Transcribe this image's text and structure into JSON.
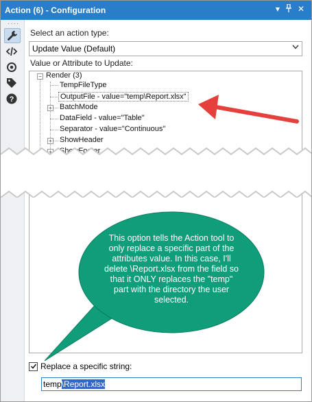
{
  "window": {
    "title": "Action (6) - Configuration"
  },
  "titlebar_icons": [
    "chevron-down-icon",
    "pin-icon",
    "close-icon"
  ],
  "sidebar": {
    "items": [
      {
        "name": "wrench-icon",
        "active": true
      },
      {
        "name": "code-icon",
        "active": false
      },
      {
        "name": "target-icon",
        "active": false
      },
      {
        "name": "tag-icon",
        "active": false
      },
      {
        "name": "help-icon",
        "active": false
      }
    ],
    "footer_icon": "checkmark-circle-icon"
  },
  "action_type": {
    "label": "Select an action type:",
    "value": "Update Value (Default)"
  },
  "tree": {
    "label": "Value or Attribute to Update:",
    "root": "Render (3)",
    "items": [
      {
        "text": "TempFileType",
        "expandable": false
      },
      {
        "text": "OutputFile - value=\"temp\\Report.xlsx\"",
        "expandable": false,
        "selected": true
      },
      {
        "text": "BatchMode",
        "expandable": true
      },
      {
        "text": "DataField - value=\"Table\"",
        "expandable": false
      },
      {
        "text": "Separator - value=\"Continuous\"",
        "expandable": false
      },
      {
        "text": "ShowHeader",
        "expandable": true
      },
      {
        "text": "ShowFooter",
        "expandable": true
      }
    ]
  },
  "replace": {
    "checkbox_label": "Replace a specific string:",
    "checked": true,
    "value_plain": "temp",
    "value_selected": "\\Report.xlsx"
  },
  "callout": {
    "text": "This option tells the Action tool to only replace a specific part of the attributes value. In this case, I'll delete \\Report.xlsx from the field so that it ONLY replaces the \"temp\" part with the directory the user selected.",
    "color": "#0f9d7a"
  },
  "colors": {
    "titlebar": "#2a7ec9",
    "arrow": "#e5403c"
  }
}
